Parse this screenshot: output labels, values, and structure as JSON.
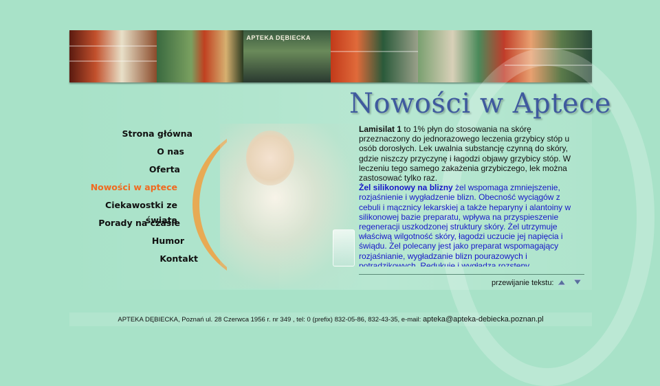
{
  "banner": {
    "sign_text": "APTEKA DĘBIECKA"
  },
  "header": {
    "title": "Nowości w Aptece"
  },
  "nav": {
    "items": [
      {
        "label": "Strona główna",
        "active": false
      },
      {
        "label": "O nas",
        "active": false
      },
      {
        "label": "Oferta",
        "active": false
      },
      {
        "label": "Nowości w aptece",
        "active": true
      },
      {
        "label": "Ciekawostki ze świata",
        "active": false
      },
      {
        "label": "Porady na czasie",
        "active": false
      },
      {
        "label": "Humor",
        "active": false
      },
      {
        "label": "Kontakt",
        "active": false
      }
    ]
  },
  "content": {
    "article1_name": "Lamisilat 1",
    "article1_text": " to 1% płyn do stosowania na skórę przeznaczony do jednorazowego leczenia grzybicy stóp u osób dorosłych. Lek uwalnia substancję czynną do skóry, gdzie niszczy przyczynę i łagodzi objawy grzybicy stóp. W leczeniu tego samego zakażenia grzybiczego, lek można zastosować tylko raz.",
    "article2_name": "Żel silikonowy na blizny",
    "article2_text": " żel wspomaga zmniejszenie, rozjaśnienie i wygładzenie blizn. Obecność wyciągów z cebuli i mącznicy lekarskiej a także heparyny i alantoiny w silikonowej bazie preparatu, wpływa na przyspieszenie regeneracji uszkodzonej struktury skóry. Żel utrzymuje właściwą wilgotność skóry, łagodzi uczucie jej napięcia i świądu. Żel polecany jest jako preparat wspomagający rozjaśnianie, wygładzanie blizn pourazowych i potrądzikowych. Redukuje i wygładza rozstępy."
  },
  "scroll": {
    "label": "przewijanie tekstu:"
  },
  "footer": {
    "address": "APTEKA DĘBIECKA, Poznań ul. 28 Czerwca 1956 r. nr 349 , tel: 0 (prefix) 832-05-86, 832-43-35, e-mail: ",
    "email": "apteka@apteka-debiecka.poznan.pl"
  },
  "colors": {
    "background": "#a8e2c8",
    "title": "#3f5a9e",
    "nav_active": "#f06a20",
    "article2": "#1616c8",
    "arrow": "#5a6e9e"
  },
  "icons": {
    "scroll_up": "triangle-up-icon",
    "scroll_down": "triangle-down-icon"
  }
}
